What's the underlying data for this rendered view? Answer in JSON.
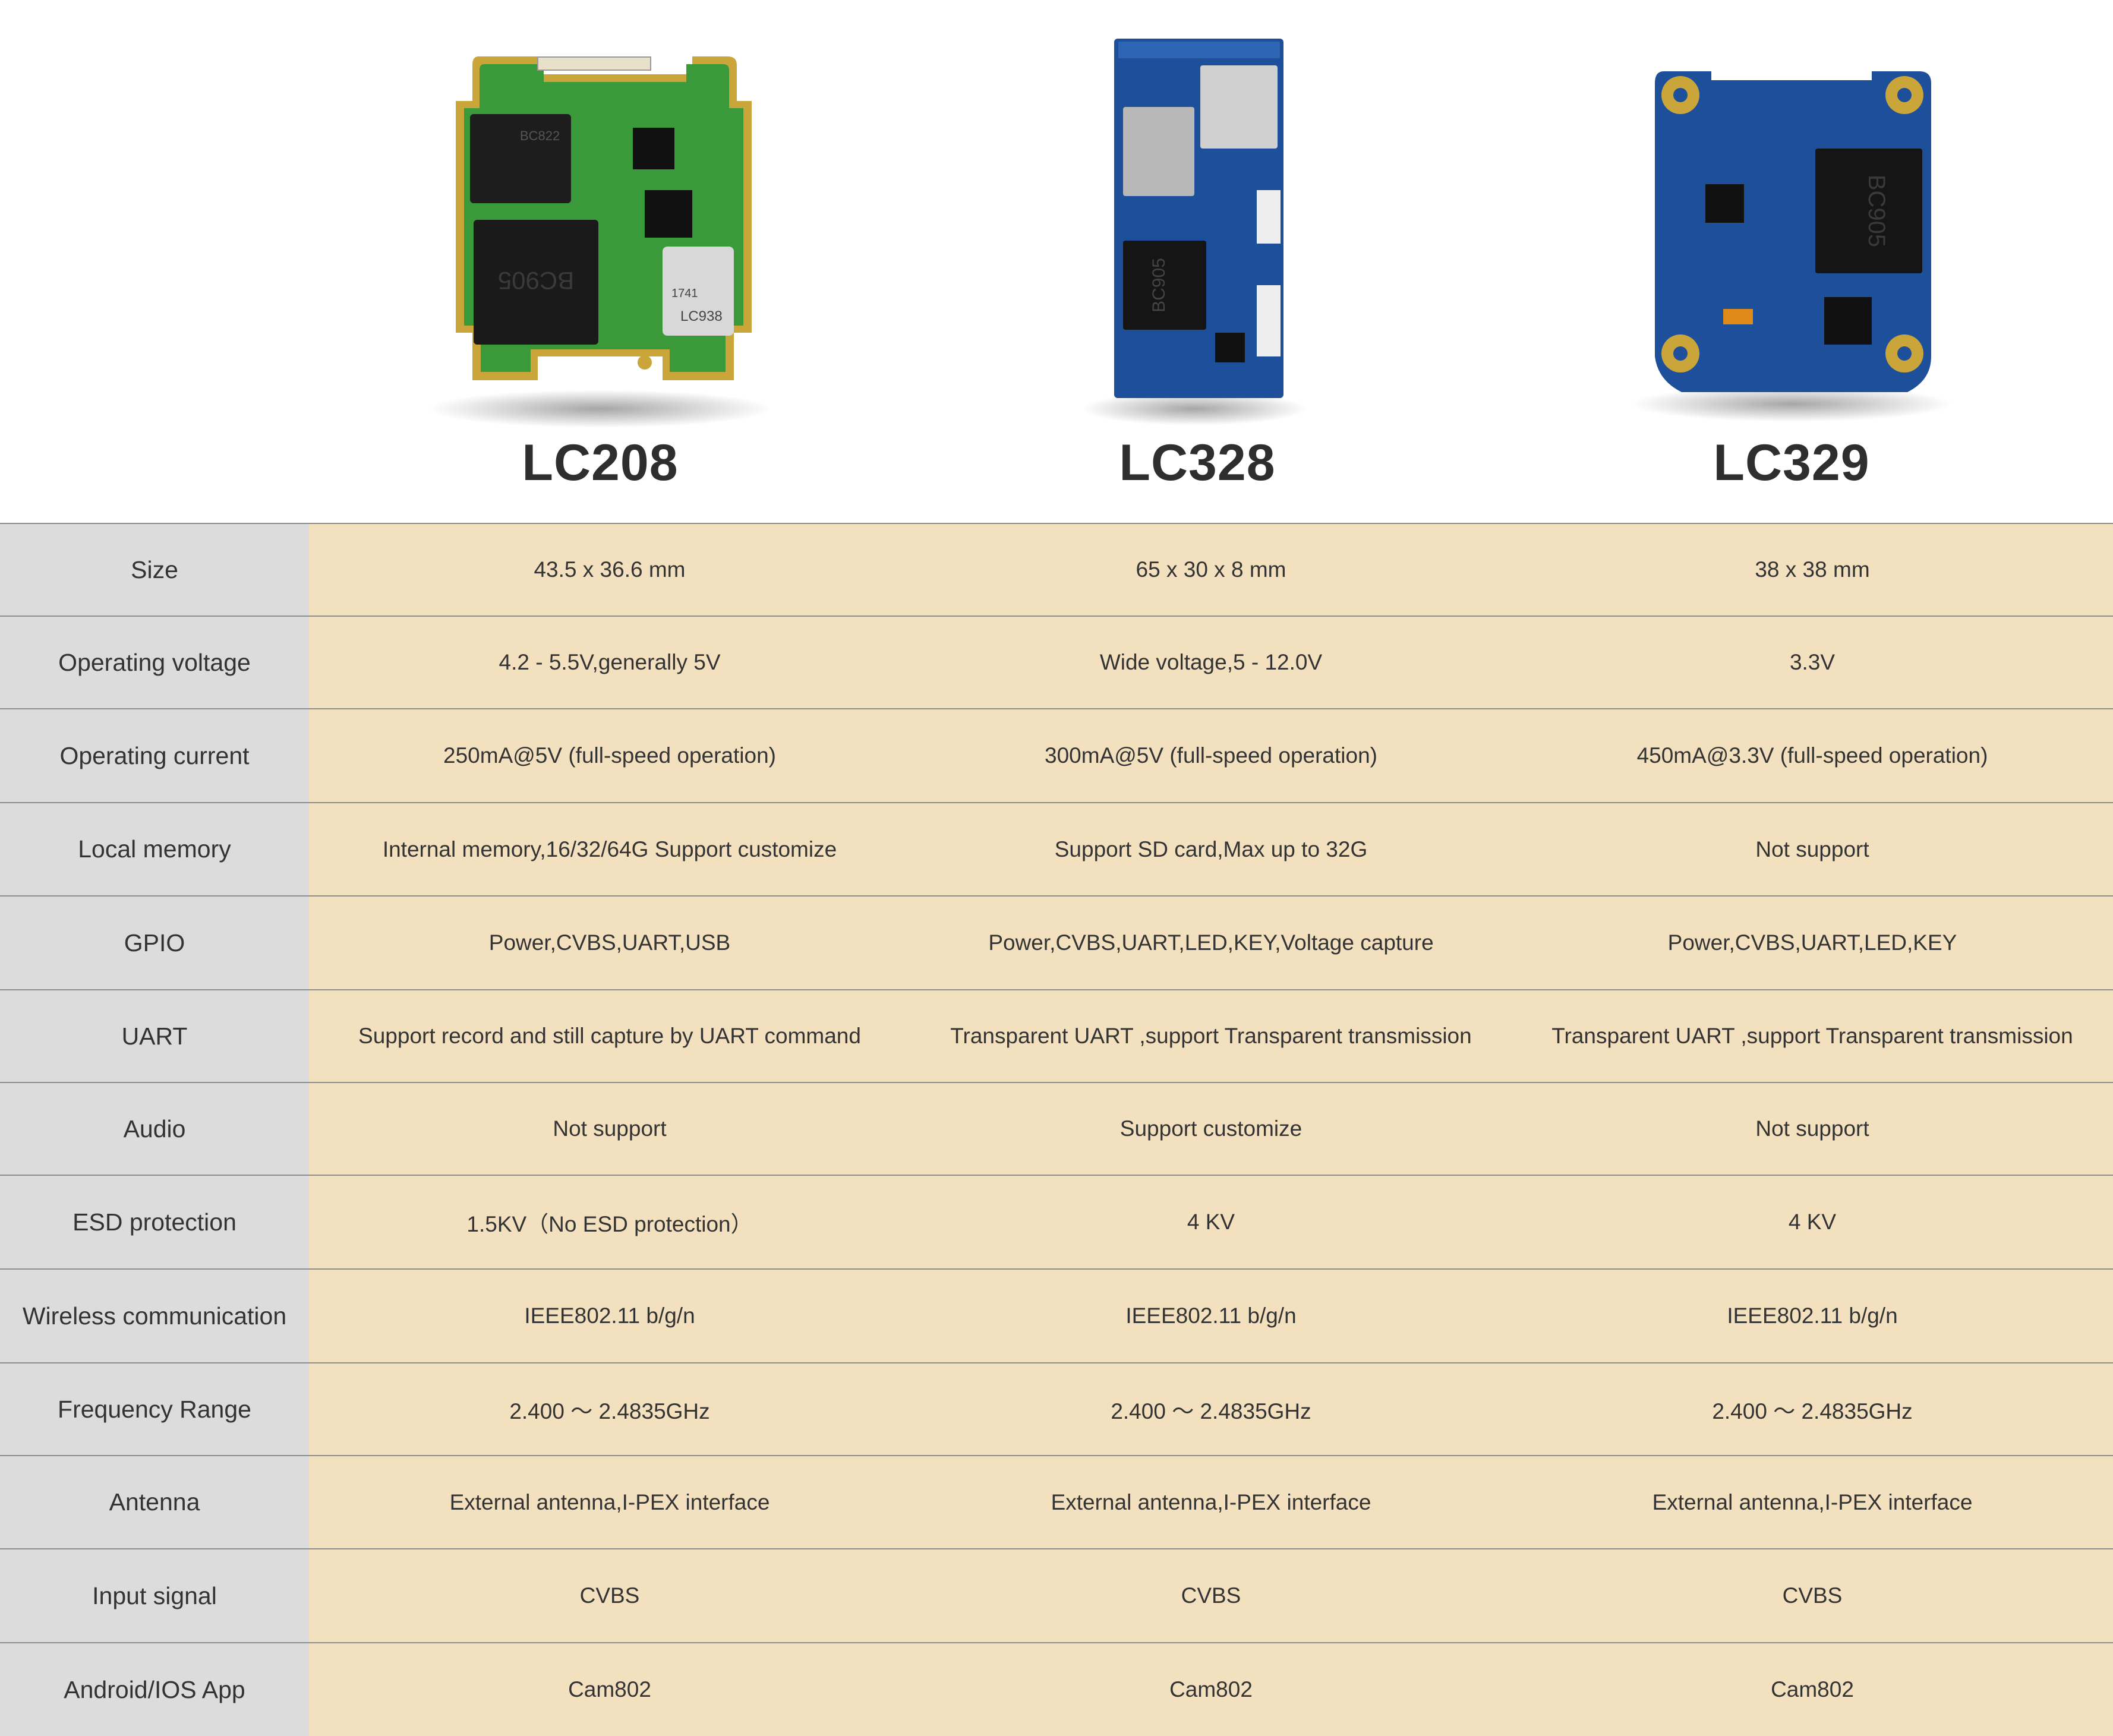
{
  "products": [
    {
      "name": "LC208",
      "board": "green",
      "chip_main": "BC905",
      "chip_module": "LC938",
      "module_code": "1741",
      "chip_top": "BC822"
    },
    {
      "name": "LC328",
      "board": "blue",
      "chip_main": "BC905"
    },
    {
      "name": "LC329",
      "board": "blue",
      "chip_main": "BC905"
    }
  ],
  "colors": {
    "label_bg": "#dcdcdc",
    "value_bg": "#f2e0bf",
    "divider": "#8f8f8f",
    "green_pcb": "#3a9a3a",
    "blue_pcb": "#1d4f9a",
    "gold": "#c9a53a"
  },
  "rows": [
    {
      "label": "Size",
      "values": [
        "43.5 x 36.6 mm",
        "65 x 30 x 8 mm",
        "38 x 38 mm"
      ]
    },
    {
      "label": "Operating voltage",
      "values": [
        "4.2 - 5.5V,generally 5V",
        "Wide voltage,5 - 12.0V",
        "3.3V"
      ]
    },
    {
      "label": "Operating current",
      "values": [
        "250mA@5V (full-speed operation)",
        "300mA@5V  (full-speed operation)",
        "450mA@3.3V  (full-speed operation)"
      ]
    },
    {
      "label": "Local memory",
      "values": [
        "Internal memory,16/32/64G Support customize",
        "Support SD card,Max up to 32G",
        "Not support"
      ]
    },
    {
      "label": "GPIO",
      "values": [
        "Power,CVBS,UART,USB",
        "Power,CVBS,UART,LED,KEY,Voltage capture",
        "Power,CVBS,UART,LED,KEY"
      ]
    },
    {
      "label": "UART",
      "values": [
        "Support record and still capture by UART command",
        "Transparent UART ,support Transparent transmission",
        "Transparent UART ,support Transparent transmission"
      ]
    },
    {
      "label": "Audio",
      "values": [
        "Not support",
        "Support customize",
        "Not support"
      ]
    },
    {
      "label": "ESD protection",
      "values": [
        "1.5KV（No ESD protection）",
        "4 KV",
        "4 KV"
      ]
    },
    {
      "label": "Wireless communication",
      "values": [
        "IEEE802.11 b/g/n",
        "IEEE802.11 b/g/n",
        "IEEE802.11 b/g/n"
      ]
    },
    {
      "label": "Frequency Range",
      "values": [
        "2.400 ～ 2.4835GHz",
        "2.400 ～ 2.4835GHz",
        "2.400 ～ 2.4835GHz"
      ]
    },
    {
      "label": "Antenna",
      "values": [
        "External antenna,I-PEX interface",
        "External antenna,I-PEX interface",
        "External antenna,I-PEX interface"
      ]
    },
    {
      "label": "Input signal",
      "values": [
        "CVBS",
        "CVBS",
        "CVBS"
      ]
    },
    {
      "label": "Android/IOS App",
      "values": [
        "Cam802",
        "Cam802",
        "Cam802"
      ]
    }
  ]
}
